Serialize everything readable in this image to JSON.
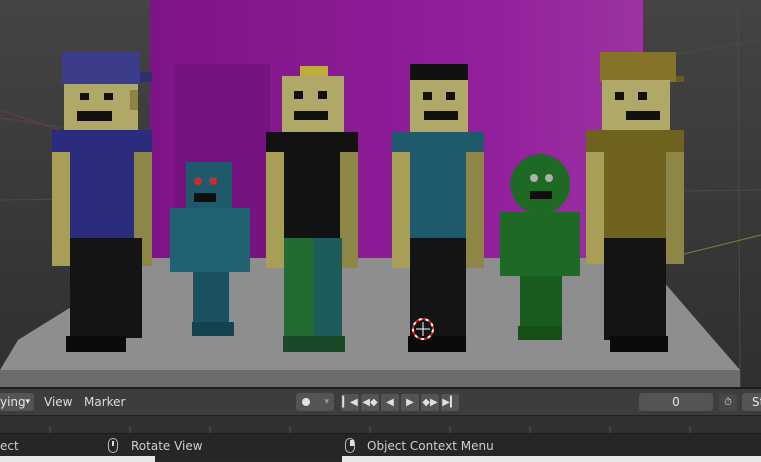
{
  "timeline": {
    "mode_value": "ying",
    "menu_view": "View",
    "menu_marker": "Marker",
    "current_frame": "0",
    "start_label": "St"
  },
  "statusbar": {
    "left_action": "ect",
    "middle_action": "Rotate View",
    "right_action": "Object Context Menu"
  },
  "colors": {
    "viewport_bg": "#3a3a3a",
    "backdrop_magenta": "#8a1a92",
    "floor": "#8c8c8c",
    "accent_play": "#e0e0e0"
  },
  "icons": {
    "record": "record-dot-icon",
    "jump_start": "jump-to-start-icon",
    "prev_keyframe": "previous-keyframe-icon",
    "play_reverse": "play-reverse-icon",
    "play": "play-icon",
    "next_keyframe": "next-keyframe-icon",
    "jump_end": "jump-to-end-icon",
    "stopwatch": "stopwatch-icon",
    "mouse_middle": "mouse-middle-button-icon",
    "mouse_right": "mouse-right-button-icon",
    "cursor_3d": "3d-cursor-icon"
  }
}
